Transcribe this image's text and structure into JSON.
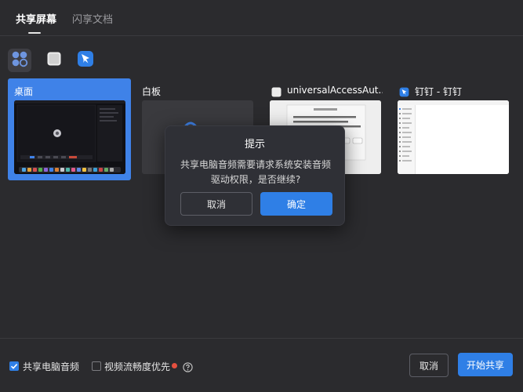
{
  "tabs": [
    {
      "label": "共享屏幕",
      "active": true
    },
    {
      "label": "闪享文档",
      "active": false
    }
  ],
  "filters": [
    {
      "icon": "grid-apps-icon",
      "selected": true
    },
    {
      "icon": "window-icon",
      "selected": false
    },
    {
      "icon": "dingtalk-icon",
      "selected": false
    }
  ],
  "sources": [
    {
      "title": "桌面",
      "kind": "desktop",
      "selected": true
    },
    {
      "title": "白板",
      "kind": "whiteboard",
      "selected": false
    },
    {
      "title": "universalAccessAut...",
      "kind": "window",
      "selected": false
    },
    {
      "title": "钉钉 - 钉钉",
      "kind": "app-window",
      "selected": false
    }
  ],
  "dialog": {
    "title": "提示",
    "message": "共享电脑音频需要请求系统安装音频驱动权限，是否继续?",
    "cancel_label": "取消",
    "confirm_label": "确定"
  },
  "bottom": {
    "share_audio_label": "共享电脑音频",
    "share_audio_checked": true,
    "video_priority_label": "视频流畅度优先",
    "video_priority_checked": false,
    "cancel_label": "取消",
    "start_label": "开始共享"
  },
  "colors": {
    "accent": "#2f7fe6",
    "background": "#2b2b2e",
    "dialog_bg": "#2f3036",
    "selected_card": "#3f82e8",
    "badge_red": "#e5503f"
  }
}
